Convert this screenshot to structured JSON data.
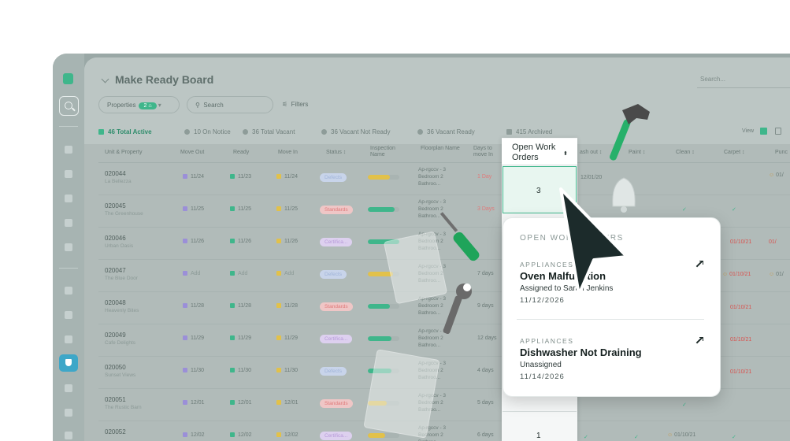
{
  "app": {
    "title": "Make Ready Board",
    "search_placeholder": "Search...",
    "filter_search_placeholder": "Search",
    "properties_label": "Properties",
    "properties_count": "2",
    "filters_label": "Filters",
    "view_label": "View"
  },
  "stats": [
    {
      "label": "46 Total Active"
    },
    {
      "label": "10 On Notice"
    },
    {
      "label": "36 Total Vacant"
    },
    {
      "label": "36 Vacant Not Ready"
    },
    {
      "label": "36 Vacant Ready"
    },
    {
      "label": "415 Archived"
    }
  ],
  "columns": {
    "unit": "Unit & Property",
    "move_out": "Move Out",
    "ready": "Ready",
    "move_in": "Move In",
    "status": "Status ↕",
    "inspection": "Inspection Name",
    "floorplan": "Floorplan Name",
    "days_to_move_in": "Days to move In",
    "open_work_orders": "Open Work Orders",
    "wash_out": "ash out ↕",
    "paint": "Paint ↕",
    "clean": "Clean ↕",
    "carpet": "Carpet ↕",
    "punch": "Punc"
  },
  "rows": [
    {
      "id": "020044",
      "name": "La Bellezza",
      "move_out": "11/24",
      "ready": "11/23",
      "move_in": "11/24",
      "status": "Defects",
      "floorplan": "Ap-rgccv - 3 Bedroom 2 Bathroo...",
      "days": "1 Day"
    },
    {
      "id": "020045",
      "name": "The Greenhouse",
      "move_out": "11/25",
      "ready": "11/25",
      "move_in": "11/25",
      "status": "Standards",
      "floorplan": "Ap-rgccv - 3 Bedroom 2 Bathroo...",
      "days": "3 Days"
    },
    {
      "id": "020046",
      "name": "Urban Oasis",
      "move_out": "11/26",
      "ready": "11/26",
      "move_in": "11/26",
      "status": "Certifica...",
      "floorplan": "Ap-rgccv - 3 Bedroom 2 Bathroo...",
      "days": ""
    },
    {
      "id": "020047",
      "name": "The Blue Door",
      "move_out": "Add",
      "ready": "Add",
      "move_in": "Add",
      "status": "Defects",
      "floorplan": "Ap-rgccv - 3 Bedroom 2 Bathroo...",
      "days": "7 days"
    },
    {
      "id": "020048",
      "name": "Heavenly Bites",
      "move_out": "11/28",
      "ready": "11/28",
      "move_in": "11/28",
      "status": "Standards",
      "floorplan": "Ap-rgccv - 3 Bedroom 2 Bathroo...",
      "days": "9 days"
    },
    {
      "id": "020049",
      "name": "Cafe Delights",
      "move_out": "11/29",
      "ready": "11/29",
      "move_in": "11/29",
      "status": "Certifica...",
      "floorplan": "Ap-rgccv - 3 Bedroom 2 Bathroo...",
      "days": "12 days"
    },
    {
      "id": "020050",
      "name": "Sunset Views",
      "move_out": "11/30",
      "ready": "11/30",
      "move_in": "11/30",
      "status": "Defects",
      "floorplan": "Ap-rgccv - 3 Bedroom 2 Bathroo...",
      "days": "4 days"
    },
    {
      "id": "020051",
      "name": "The Rustic Barn",
      "move_out": "12/01",
      "ready": "12/01",
      "move_in": "12/01",
      "status": "Standards",
      "floorplan": "Ap-rgccv - 3 Bedroom 2 Bathroo...",
      "days": "5 days"
    },
    {
      "id": "020052",
      "name": "",
      "move_out": "12/02",
      "ready": "12/02",
      "move_in": "12/02",
      "status": "Certifica...",
      "floorplan": "Ap-rgccv - 3 Bedroom 2 Bathroo...",
      "days": "6 days"
    }
  ],
  "open_work_orders": {
    "first": "3",
    "last": "1"
  },
  "extra_cells": {
    "wash_date": "12/01/20",
    "date_a": "01/10/21",
    "date_b": "01/10/21",
    "date_c": "01/10/21",
    "date_d": "01/10/21",
    "date_e": "01/10/21",
    "date_f": "01/10/21",
    "punch_a": "01/",
    "punch_b": "01/",
    "punch_c": "01/"
  },
  "popup": {
    "heading": "OPEN WORK ORDERS",
    "items": [
      {
        "category": "APPLIANCES",
        "title": "Oven Malfunction",
        "assigned": "Assigned to Sarah Jenkins",
        "date": "11/12/2026"
      },
      {
        "category": "APPLIANCES",
        "title": "Dishwasher Not Draining",
        "assigned": "Unassigned",
        "date": "11/14/2026"
      }
    ]
  }
}
